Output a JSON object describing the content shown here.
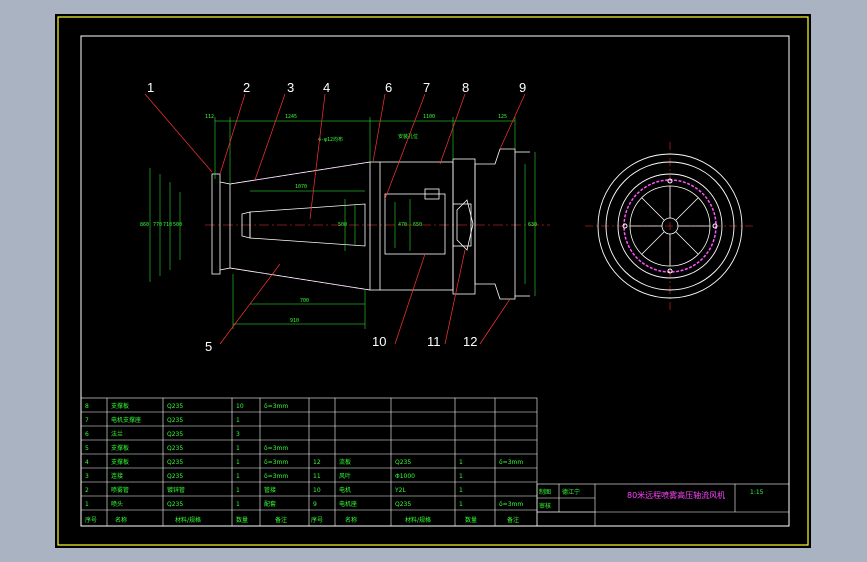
{
  "drawing": {
    "title": "80米远程喷雾高压轴流风机",
    "scale": "1:15",
    "labels": [
      "1",
      "2",
      "3",
      "4",
      "5",
      "6",
      "7",
      "8",
      "9",
      "10",
      "11",
      "12"
    ],
    "dims": {
      "top_left": "112",
      "top_mid": "1245",
      "top_right": "1100",
      "top_far": "125",
      "inner": "1070",
      "holes": "4-φ12均布",
      "note": "安装孔位",
      "bot1": "700",
      "bot2": "910",
      "v1": "860",
      "v2": "770",
      "v3": "710",
      "v4": "500",
      "v5": "500",
      "v6": "470",
      "v7": "650",
      "v8": "630"
    }
  },
  "bom": {
    "rows": [
      {
        "no": "8",
        "name": "支撑板",
        "mat": "Q235",
        "qty": "10",
        "note": "δ=3mm",
        "no2": "",
        "name2": "",
        "mat2": "",
        "qty2": "",
        "note2": ""
      },
      {
        "no": "7",
        "name": "电机支撑座",
        "mat": "Q235",
        "qty": "1",
        "note": "",
        "no2": "",
        "name2": "",
        "mat2": "",
        "qty2": "",
        "note2": ""
      },
      {
        "no": "6",
        "name": "法兰",
        "mat": "Q235",
        "qty": "3",
        "note": "",
        "no2": "",
        "name2": "",
        "mat2": "",
        "qty2": "",
        "note2": ""
      },
      {
        "no": "5",
        "name": "支撑板",
        "mat": "Q235",
        "qty": "1",
        "note": "δ=3mm",
        "no2": "",
        "name2": "",
        "mat2": "",
        "qty2": "",
        "note2": ""
      },
      {
        "no": "4",
        "name": "支撑板",
        "mat": "Q235",
        "qty": "1",
        "note": "δ=3mm",
        "no2": "12",
        "name2": "流板",
        "mat2": "Q235",
        "qty2": "1",
        "note2": "δ=3mm"
      },
      {
        "no": "3",
        "name": "连接",
        "mat": "Q235",
        "qty": "1",
        "note": "δ=3mm",
        "no2": "11",
        "name2": "风叶",
        "mat2": "Φ1000",
        "qty2": "1",
        "note2": ""
      },
      {
        "no": "2",
        "name": "喷雾管",
        "mat": "镀锌管",
        "qty": "1",
        "note": "管接",
        "no2": "10",
        "name2": "电机",
        "mat2": "Y2L",
        "qty2": "1",
        "note2": ""
      },
      {
        "no": "1",
        "name": "喷头",
        "mat": "Q235",
        "qty": "1",
        "note": "配套",
        "no2": "9",
        "name2": "电机座",
        "mat2": "Q235",
        "qty2": "1",
        "note2": "δ=3mm"
      }
    ],
    "header": {
      "no": "序号",
      "name": "名称",
      "mat": "材料/规格",
      "qty": "数量",
      "note": "备注"
    },
    "title_block": {
      "design": "制图",
      "school": "德江宁",
      "check": "审核"
    }
  }
}
